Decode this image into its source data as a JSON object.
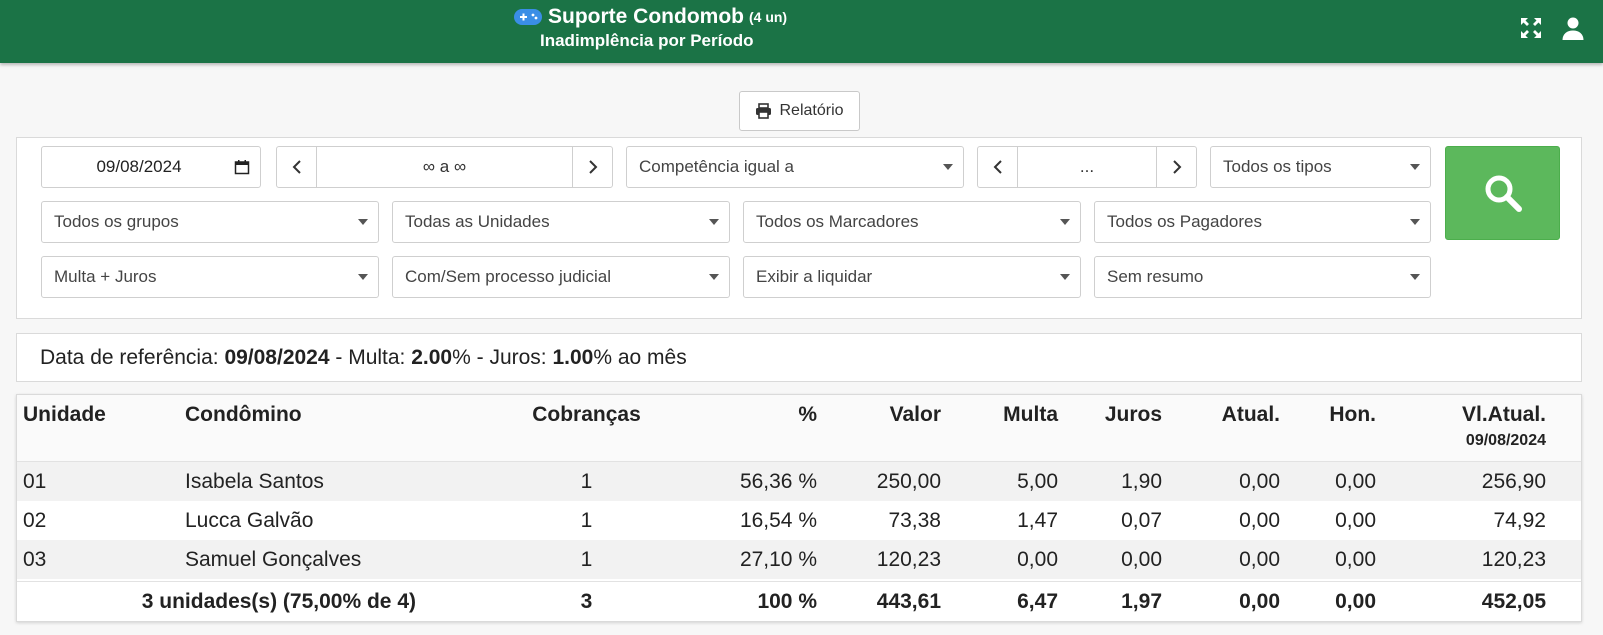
{
  "header": {
    "title": "Suporte Condomob",
    "unit_count": "(4 un)",
    "subtitle": "Inadimplência por Período",
    "icons": [
      "gamepad-icon",
      "expand-icon",
      "user-icon"
    ],
    "color": "#1b7346"
  },
  "report_button": {
    "label": "Relatório"
  },
  "filters": {
    "date": "09/08/2024",
    "period": "∞ a ∞",
    "competencia": "Competência igual a",
    "competencia_value": "...",
    "tipos": "Todos os tipos",
    "grupos": "Todos os grupos",
    "unidades": "Todas as Unidades",
    "marcadores": "Todos os Marcadores",
    "pagadores": "Todos os Pagadores",
    "encargos": "Multa + Juros",
    "processo": "Com/Sem processo judicial",
    "liquidar": "Exibir a liquidar",
    "resumo": "Sem resumo"
  },
  "search_button_color": "#5cb85c",
  "reference": {
    "label_date": "Data de referência: ",
    "date": "09/08/2024",
    "label_multa": " - Multa: ",
    "multa": "2.00",
    "label_juros": "% - Juros: ",
    "juros": "1.00",
    "suffix": "% ao mês"
  },
  "table": {
    "headers": {
      "unidade": "Unidade",
      "condomino": "Condômino",
      "cobrancas": "Cobranças",
      "percent": "%",
      "valor": "Valor",
      "multa": "Multa",
      "juros": "Juros",
      "atual": "Atual.",
      "hon": "Hon.",
      "vlatual": "Vl.Atual.",
      "vlatual_date": "09/08/2024"
    },
    "rows": [
      {
        "unidade": "01",
        "condomino": "Isabela Santos",
        "cobrancas": "1",
        "percent": "56,36 %",
        "valor": "250,00",
        "multa": "5,00",
        "juros": "1,90",
        "atual": "0,00",
        "hon": "0,00",
        "vlatual": "256,90"
      },
      {
        "unidade": "02",
        "condomino": "Lucca Galvão",
        "cobrancas": "1",
        "percent": "16,54 %",
        "valor": "73,38",
        "multa": "1,47",
        "juros": "0,07",
        "atual": "0,00",
        "hon": "0,00",
        "vlatual": "74,92"
      },
      {
        "unidade": "03",
        "condomino": "Samuel Gonçalves",
        "cobrancas": "1",
        "percent": "27,10 %",
        "valor": "120,23",
        "multa": "0,00",
        "juros": "0,00",
        "atual": "0,00",
        "hon": "0,00",
        "vlatual": "120,23"
      }
    ],
    "footer": {
      "summary": "3 unidades(s) (75,00% de 4)",
      "cobrancas": "3",
      "percent": "100 %",
      "valor": "443,61",
      "multa": "6,47",
      "juros": "1,97",
      "atual": "0,00",
      "hon": "0,00",
      "vlatual": "452,05"
    }
  }
}
